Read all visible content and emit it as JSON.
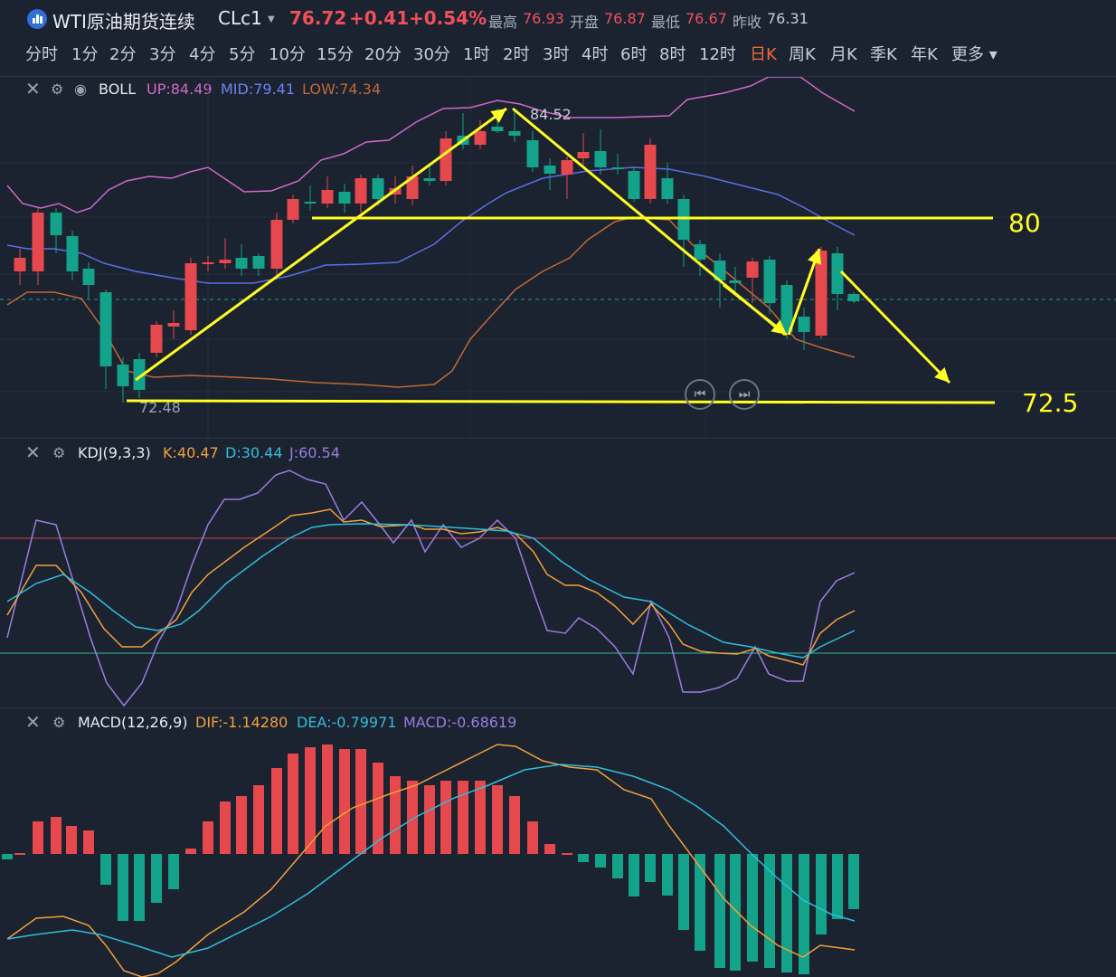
{
  "header": {
    "title": "WTI原油期货连续",
    "code": "CLc1",
    "price": "76.72",
    "change": "+0.41",
    "change_pct": "+0.54%",
    "high_label": "最高",
    "high": "76.93",
    "open_label": "开盘",
    "open": "76.87",
    "low_label": "最低",
    "low": "76.67",
    "prev_label": "昨收",
    "prev": "76.31"
  },
  "tabs": [
    "分时",
    "1分",
    "2分",
    "3分",
    "4分",
    "5分",
    "10分",
    "15分",
    "20分",
    "30分",
    "1时",
    "2时",
    "3时",
    "4时",
    "6时",
    "8时",
    "12时",
    "日K",
    "周K",
    "月K",
    "季K",
    "年K",
    "更多"
  ],
  "active_tab": "日K",
  "boll": {
    "name": "BOLL",
    "up": "UP:84.49",
    "mid": "MID:79.41",
    "low": "LOW:74.34",
    "high_mark": "84.52",
    "low_mark": "72.48",
    "level_80": "80",
    "level_72": "72.5"
  },
  "kdj": {
    "name": "KDJ(9,3,3)",
    "k": "K:40.47",
    "d": "D:30.44",
    "j": "J:60.54"
  },
  "macd": {
    "name": "MACD(12,26,9)",
    "dif": "DIF:-1.14280",
    "dea": "DEA:-0.79971",
    "macd": "MACD:-0.68619"
  },
  "colors": {
    "up": "#e5484d",
    "down": "#12a38a",
    "boll_up": "#d06ac7",
    "boll_mid": "#5b6fe6",
    "boll_low": "#c06a35",
    "annot": "#ffff22"
  },
  "icons": [
    "close-icon",
    "gear-icon",
    "eye-icon",
    "prev-icon",
    "next-icon",
    "caret-down-icon"
  ]
}
